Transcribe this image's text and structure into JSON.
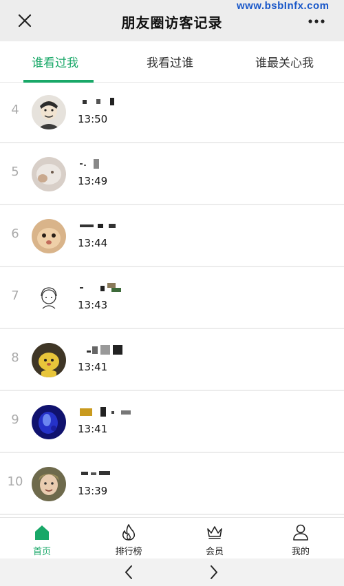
{
  "header": {
    "title": "朋友圈访客记录"
  },
  "watermark": "www.bsbInfx.com",
  "tabs": [
    {
      "label": "谁看过我",
      "active": true
    },
    {
      "label": "我看过谁",
      "active": false
    },
    {
      "label": "谁最关心我",
      "active": false
    }
  ],
  "visitors": [
    {
      "rank": "4",
      "time": "13:50"
    },
    {
      "rank": "5",
      "time": "13:49"
    },
    {
      "rank": "6",
      "time": "13:44"
    },
    {
      "rank": "7",
      "time": "13:43"
    },
    {
      "rank": "8",
      "time": "13:41"
    },
    {
      "rank": "9",
      "time": "13:41"
    },
    {
      "rank": "10",
      "time": "13:39"
    }
  ],
  "nav": [
    {
      "label": "首页",
      "icon": "home-icon",
      "active": true
    },
    {
      "label": "排行榜",
      "icon": "flame-icon",
      "active": false
    },
    {
      "label": "会员",
      "icon": "crown-icon",
      "active": false
    },
    {
      "label": "我的",
      "icon": "user-icon",
      "active": false
    }
  ],
  "colors": {
    "accent": "#19a868",
    "rank": "#aaaaaa",
    "header_bg": "#ededed"
  }
}
